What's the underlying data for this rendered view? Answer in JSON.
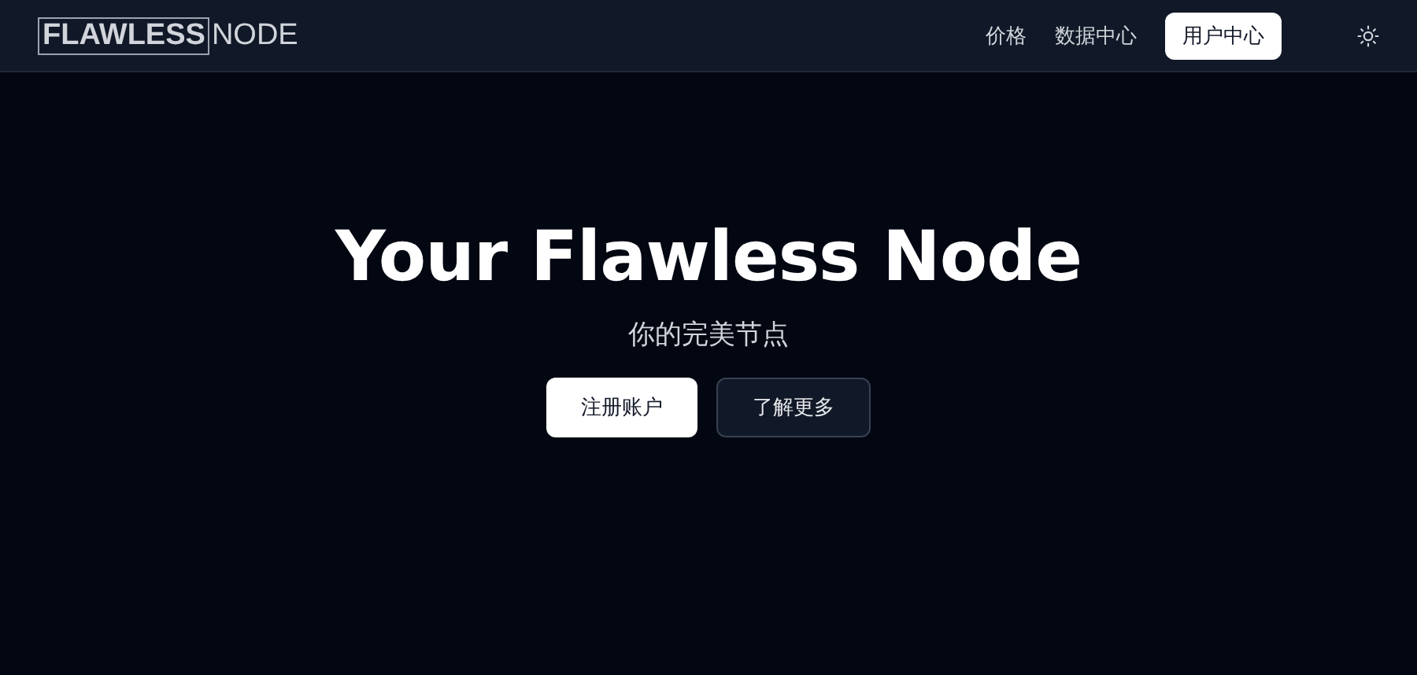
{
  "logo": {
    "boxed": "FLAWLESS",
    "plain": "NODE"
  },
  "nav": [
    {
      "label": "价格",
      "kind": "link"
    },
    {
      "label": "数据中心",
      "kind": "link"
    },
    {
      "label": "用户中心",
      "kind": "button"
    }
  ],
  "hero": {
    "title": "Your Flawless Node",
    "subtitle": "你的完美节点",
    "buttons": [
      {
        "label": "注册账户",
        "kind": "primary"
      },
      {
        "label": "了解更多",
        "kind": "secondary"
      }
    ]
  }
}
